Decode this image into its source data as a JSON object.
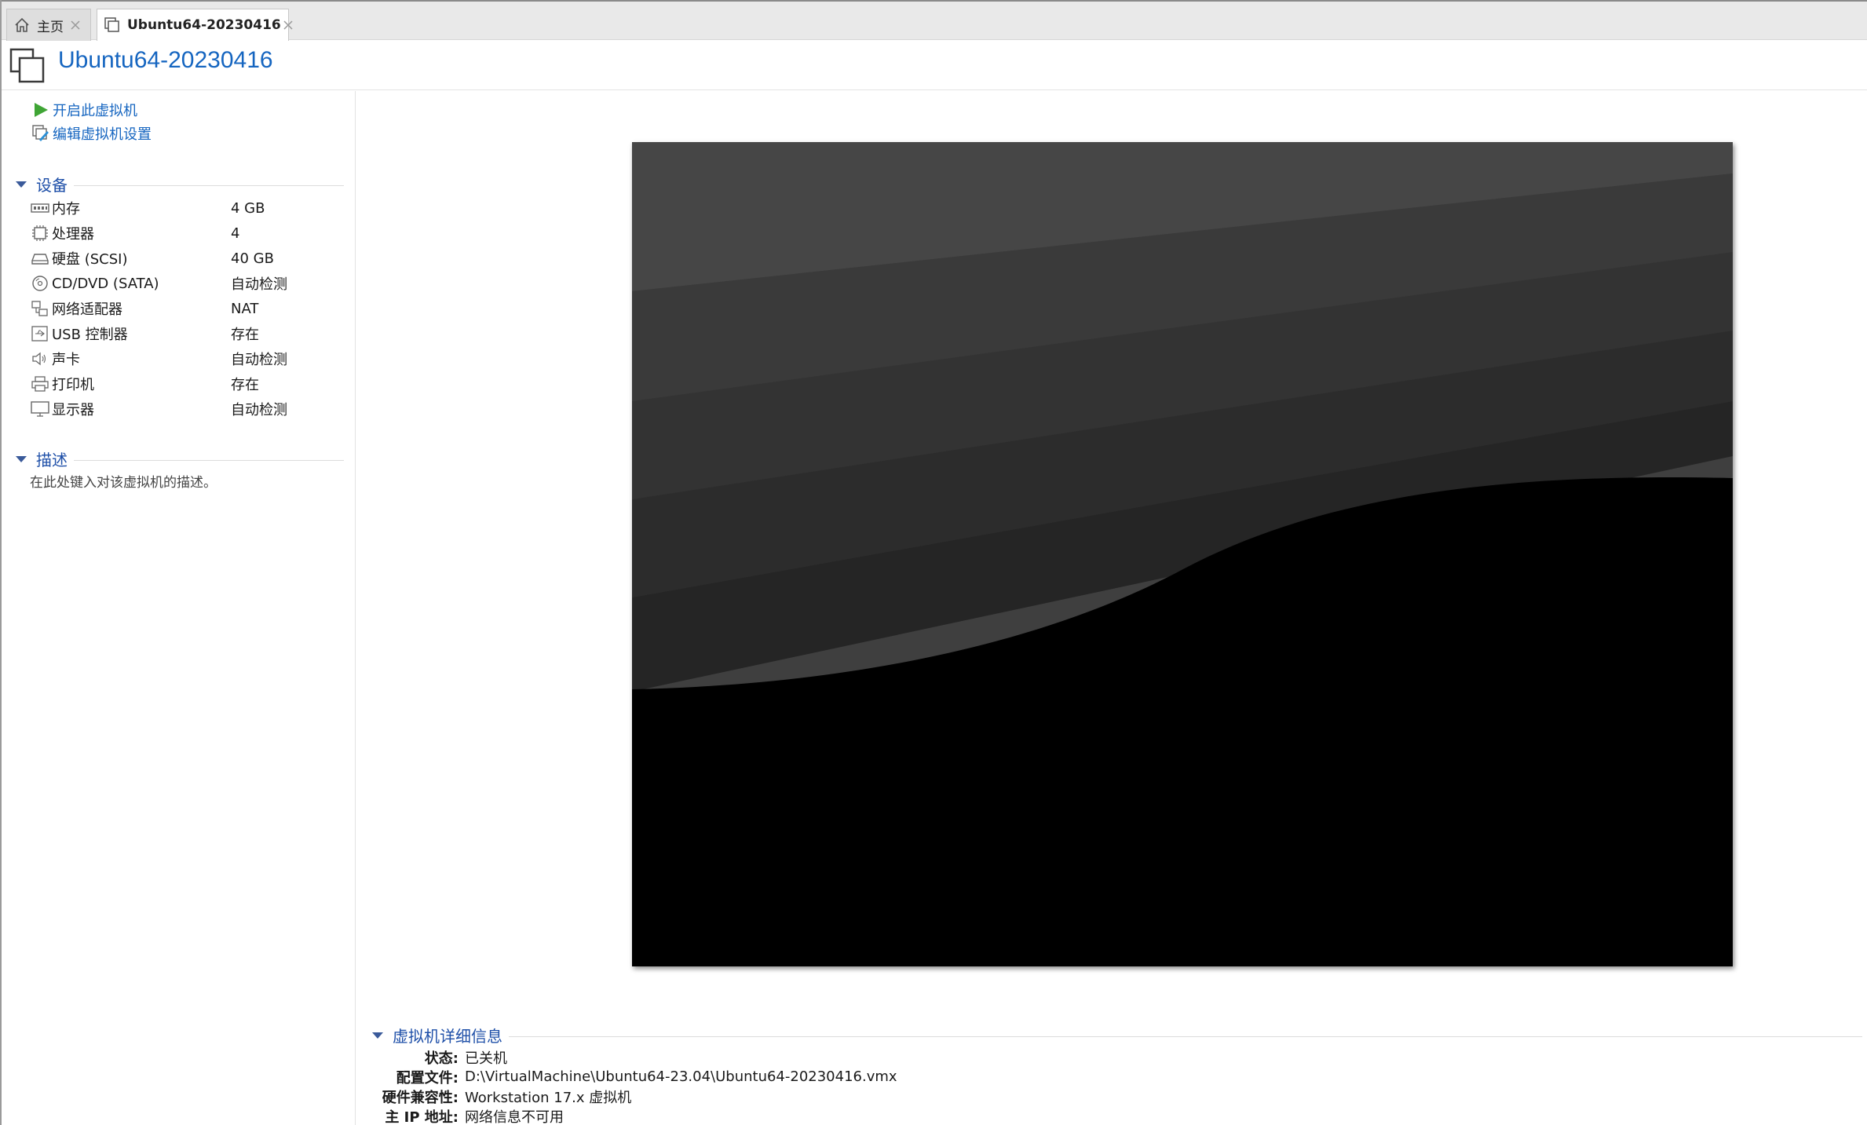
{
  "tabs": [
    {
      "label": "主页",
      "icon": "home-icon",
      "active": false
    },
    {
      "label": "Ubuntu64-20230416",
      "icon": "vm-icon",
      "active": true
    }
  ],
  "header": {
    "title": "Ubuntu64-20230416"
  },
  "actions": {
    "power_on": "开启此虚拟机",
    "edit_settings": "编辑虚拟机设置"
  },
  "devices": {
    "heading": "设备",
    "items": [
      {
        "name": "内存",
        "value": "4 GB",
        "icon": "memory-icon"
      },
      {
        "name": "处理器",
        "value": "4",
        "icon": "cpu-icon"
      },
      {
        "name": "硬盘 (SCSI)",
        "value": "40 GB",
        "icon": "harddisk-icon"
      },
      {
        "name": "CD/DVD (SATA)",
        "value": "自动检测",
        "icon": "cd-icon"
      },
      {
        "name": "网络适配器",
        "value": "NAT",
        "icon": "network-icon"
      },
      {
        "name": "USB 控制器",
        "value": "存在",
        "icon": "usb-icon"
      },
      {
        "name": "声卡",
        "value": "自动检测",
        "icon": "speaker-icon"
      },
      {
        "name": "打印机",
        "value": "存在",
        "icon": "printer-icon"
      },
      {
        "name": "显示器",
        "value": "自动检测",
        "icon": "monitor-icon"
      }
    ]
  },
  "description": {
    "heading": "描述",
    "placeholder": "在此处键入对该虚拟机的描述。"
  },
  "details": {
    "heading": "虚拟机详细信息",
    "rows": [
      {
        "key": "状态:",
        "value": "已关机"
      },
      {
        "key": "配置文件:",
        "value": "D:\\VirtualMachine\\Ubuntu64-23.04\\Ubuntu64-20230416.vmx"
      },
      {
        "key": "硬件兼容性:",
        "value": "Workstation 17.x 虚拟机"
      },
      {
        "key": "主 IP 地址:",
        "value": "网络信息不可用"
      }
    ]
  },
  "colors": {
    "link": "#1565c0",
    "section": "#1e4fa8",
    "play_green": "#3fa535"
  }
}
